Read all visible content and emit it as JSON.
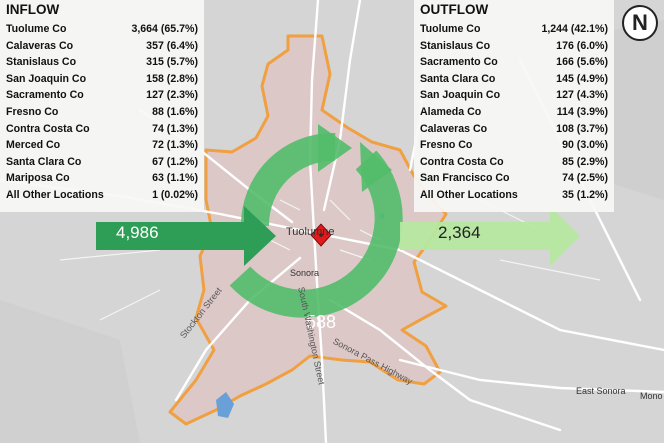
{
  "inflow": {
    "title": "INFLOW",
    "rows": [
      {
        "name": "Tuolume Co",
        "value": "3,664 (65.7%)"
      },
      {
        "name": "Calaveras Co",
        "value": "357 (6.4%)"
      },
      {
        "name": "Stanislaus Co",
        "value": "315 (5.7%)"
      },
      {
        "name": "San Joaquin Co",
        "value": "158 (2.8%)"
      },
      {
        "name": "Sacramento Co",
        "value": "127 (2.3%)"
      },
      {
        "name": "Fresno Co",
        "value": "88 (1.6%)"
      },
      {
        "name": "Contra Costa Co",
        "value": "74 (1.3%)"
      },
      {
        "name": "Merced Co",
        "value": "72 (1.3%)"
      },
      {
        "name": "Santa Clara Co",
        "value": "67 (1.2%)"
      },
      {
        "name": "Mariposa Co",
        "value": "63 (1.1%)"
      },
      {
        "name": "All Other Locations",
        "value": "1 (0.02%)"
      }
    ]
  },
  "outflow": {
    "title": "OUTFLOW",
    "rows": [
      {
        "name": "Tuolume Co",
        "value": "1,244 (42.1%)"
      },
      {
        "name": "Stanislaus Co",
        "value": "176 (6.0%)"
      },
      {
        "name": "Sacramento Co",
        "value": "166 (5.6%)"
      },
      {
        "name": "Santa Clara Co",
        "value": "145 (4.9%)"
      },
      {
        "name": "San Joaquin Co",
        "value": "127 (4.3%)"
      },
      {
        "name": "Alameda Co",
        "value": "114 (3.9%)"
      },
      {
        "name": "Calaveras Co",
        "value": "108 (3.7%)"
      },
      {
        "name": "Fresno Co",
        "value": "90 (3.0%)"
      },
      {
        "name": "Contra Costa Co",
        "value": "85 (2.9%)"
      },
      {
        "name": "San Francisco Co",
        "value": "74 (2.5%)"
      },
      {
        "name": "All Other Locations",
        "value": "35 (1.2%)"
      }
    ]
  },
  "flows": {
    "inflow_total": "4,986",
    "outflow_total": "2,364",
    "within_total": "588"
  },
  "map": {
    "north_label": "N",
    "streets": {
      "stockton": "Stockton Street",
      "washington": "South Washington Street",
      "sonora_pass": "Sonora Pass Highway"
    },
    "places": {
      "sonora": "Sonora",
      "tuolumne": "Tuolumne",
      "east_sonora": "East Sonora",
      "mono": "Mono"
    }
  },
  "colors": {
    "inflow_arrow": "#2e9e57",
    "outflow_arrow": "#b6e8a0",
    "circular_arrow": "#52bd6a",
    "boundary": "#f0a040",
    "area_fill": "#ddc8c8",
    "marker": "#e01a1a"
  }
}
